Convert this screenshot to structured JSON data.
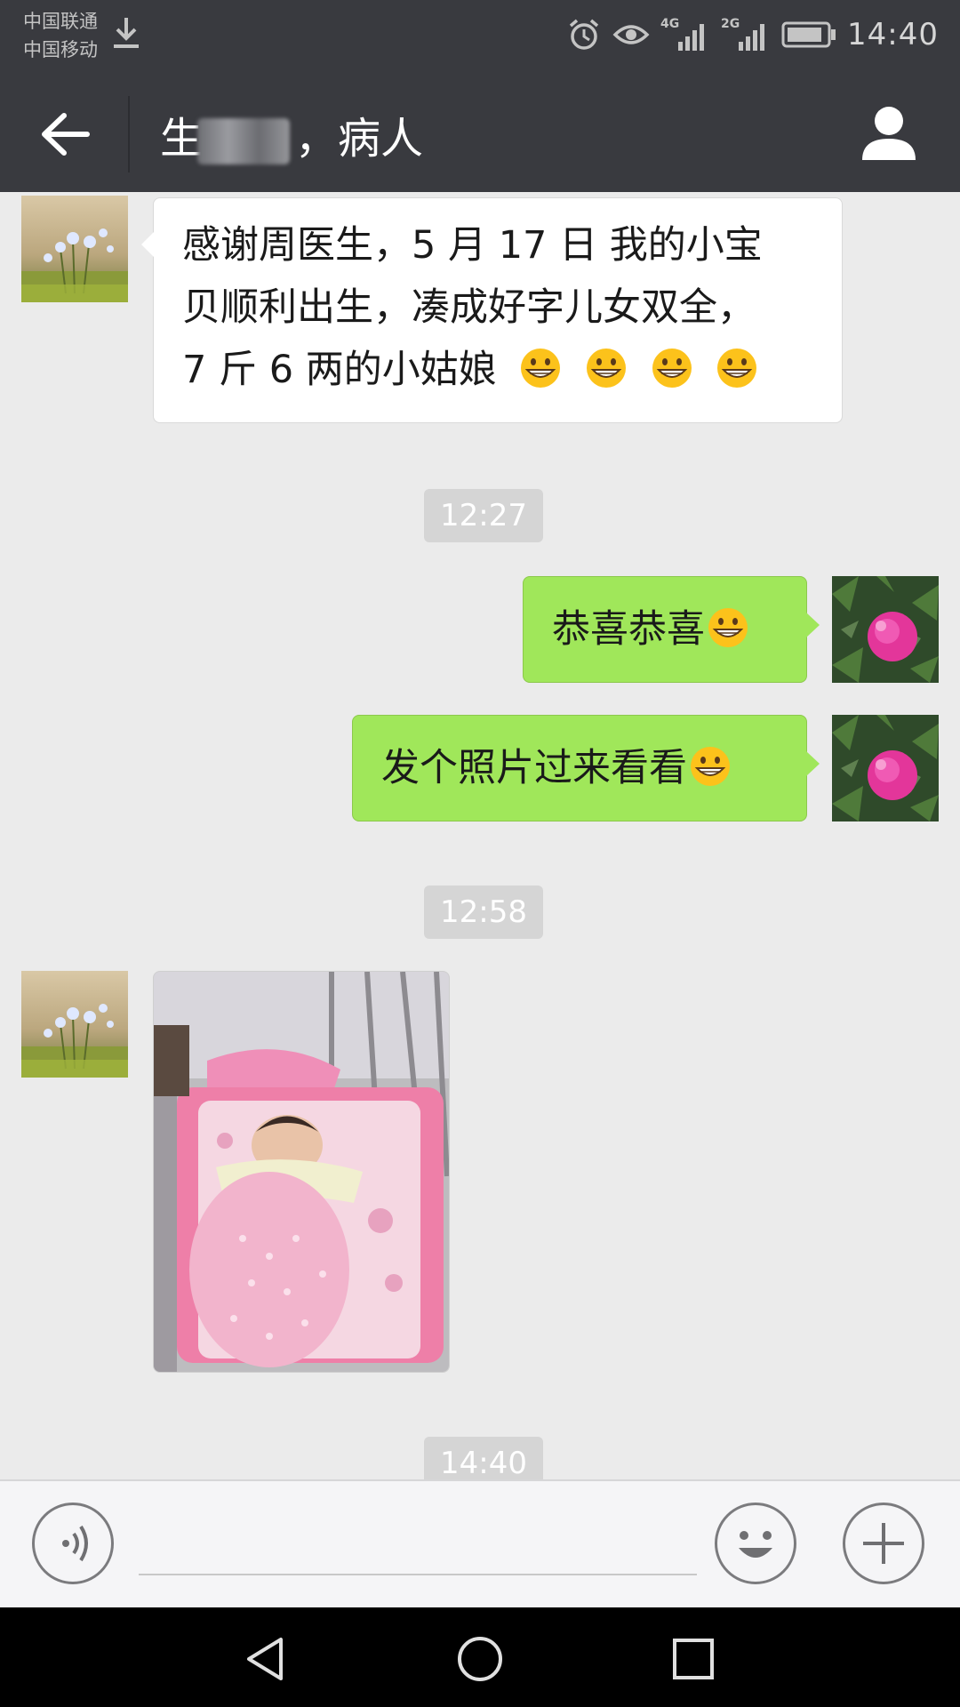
{
  "status_bar": {
    "carrier_1": "中国联通",
    "carrier_2": "中国移动",
    "network_1": "4G",
    "network_2": "2G",
    "time": "14:40",
    "icons": [
      "download-icon",
      "alarm-icon",
      "eye-icon",
      "signal-icon",
      "battery-icon"
    ]
  },
  "header": {
    "title_visible_start": "生",
    "title_suffix": "，病人",
    "back_icon": "arrow-left-icon",
    "profile_icon": "person-icon"
  },
  "messages": [
    {
      "direction": "incoming",
      "type": "text",
      "lines": [
        "感谢周医生，5 月 17 日 我的小宝",
        "贝顺利出生，凑成好字儿女双全，",
        "7 斤 6 两的小姑娘"
      ],
      "emoji_count": 4,
      "emoji": "grinning-face-icon"
    },
    {
      "type": "timestamp",
      "text": "12:27"
    },
    {
      "direction": "outgoing",
      "type": "text",
      "text": "恭喜恭喜",
      "emoji": "grinning-face-icon"
    },
    {
      "direction": "outgoing",
      "type": "text",
      "text": "发个照片过来看看",
      "emoji": "grinning-face-icon"
    },
    {
      "type": "timestamp",
      "text": "12:58"
    },
    {
      "direction": "incoming",
      "type": "image",
      "image": "newborn-in-crib-photo"
    },
    {
      "type": "timestamp",
      "text": "14:40"
    }
  ],
  "input_bar": {
    "voice_icon": "voice-icon",
    "emoji_icon": "smiley-icon",
    "more_icon": "plus-icon"
  },
  "nav_bar": {
    "icons": [
      "back-triangle-icon",
      "home-circle-icon",
      "recents-square-icon"
    ]
  }
}
